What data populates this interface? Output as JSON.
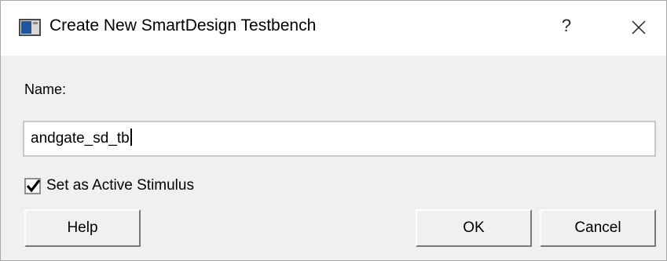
{
  "window": {
    "title": "Create New SmartDesign Testbench",
    "help_glyph": "?",
    "icons": {
      "app": "application-window-icon",
      "help": "question-mark-icon",
      "close": "close-x-icon"
    }
  },
  "form": {
    "name_label": "Name:",
    "name_value": "andgate_sd_tb",
    "active_stimulus": {
      "label": "Set as Active Stimulus",
      "checked": true
    }
  },
  "buttons": {
    "help": "Help",
    "ok": "OK",
    "cancel": "Cancel"
  },
  "colors": {
    "dialog_background": "#f0f0f0",
    "titlebar_background": "#ffffff",
    "icon_blue": "#1e56a0"
  }
}
